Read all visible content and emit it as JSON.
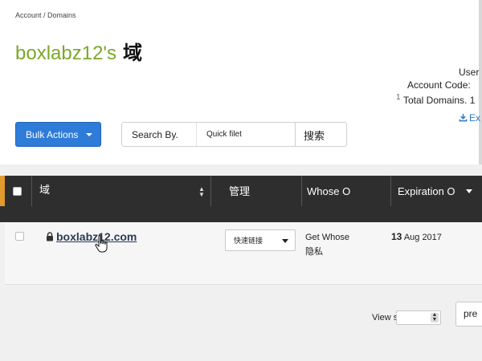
{
  "breadcrumb": "Account / Domains",
  "title": {
    "owner": "boxlabz12's",
    "label": "域"
  },
  "account_info": {
    "user_label": "User",
    "account_code_label": "Account Code:",
    "total_domains": "Total Domains. 1",
    "total_marker": "1"
  },
  "export_label": "Ex",
  "toolbar": {
    "bulk_actions": "Bulk Actions",
    "search_by": "Search By.",
    "quick_filter_placeholder": "Quick filet",
    "search_button": "搜索"
  },
  "table": {
    "columns": [
      "域",
      "管理",
      "Whose O",
      "Expiration O"
    ],
    "rows": [
      {
        "domain": "boxlabz12.com",
        "manage_select": "快速链接",
        "whois_line1": "Get Whose",
        "whois_line2": "隐私",
        "expiration_day": "13",
        "expiration_rest": "Aug 2017"
      }
    ]
  },
  "footer": {
    "view_label": "View so",
    "pager_label": "pre"
  },
  "colors": {
    "brand_green": "#7aa82a",
    "primary_blue": "#2f7bd8",
    "header_dark": "#2e2e2e",
    "accent_orange": "#e29b2c",
    "link_blue": "#2a78c8"
  },
  "icons": [
    "lock-icon",
    "download-icon",
    "sort-icon",
    "chevron-down-icon",
    "hand-cursor-icon"
  ]
}
